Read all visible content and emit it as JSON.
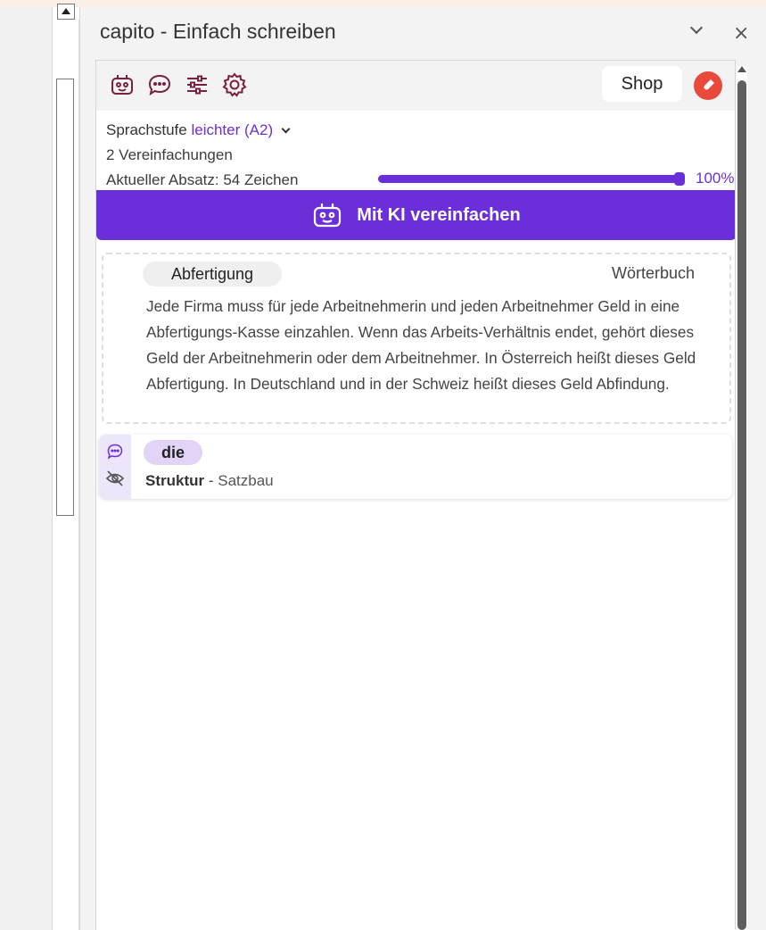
{
  "pane": {
    "title": "capito - Einfach schreiben"
  },
  "toolbar": {
    "tools": [
      "robot-icon",
      "chat-icon",
      "sliders-icon",
      "gear-icon"
    ],
    "shop_label": "Shop"
  },
  "status": {
    "level_label": "Sprachstufe",
    "level_value": "leichter (A2)",
    "simplifications": "2 Vereinfachungen",
    "paragraph": "Aktueller Absatz: 54 Zeichen",
    "progress_fraction": 1.0,
    "progress_label": "100%"
  },
  "ki_button": {
    "label": "Mit KI vereinfachen"
  },
  "dictionary_card": {
    "term": "Abfertigung",
    "source": "Wörterbuch",
    "text": "Jede Firma muss für jede Arbeitnehmerin und jeden Arbeitnehmer Geld in eine Abfertigungs-Kasse einzahlen. Wenn das Arbeits-Verhältnis endet, gehört dieses Geld der Arbeitnehmerin oder dem Arbeitnehmer. In Österreich heißt dieses Geld Abfertigung. In Deutschland und in der Schweiz heißt dieses Geld Abfindung."
  },
  "structure_card": {
    "term": "die",
    "category": "Struktur",
    "separator": " - ",
    "subcategory": "Satzbau"
  },
  "colors": {
    "accent": "#6b2fd9",
    "accent_light": "#e1d4f7",
    "logo": "#e8493b",
    "icon": "#7a1f3d"
  }
}
